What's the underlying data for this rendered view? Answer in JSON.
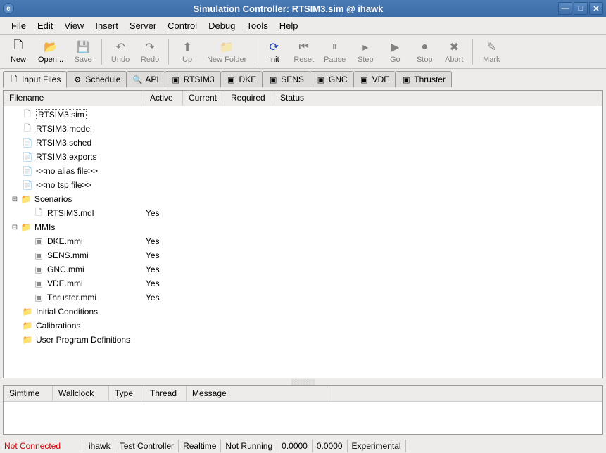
{
  "title": "Simulation Controller: RTSIM3.sim @ ihawk",
  "menu": [
    "File",
    "Edit",
    "View",
    "Insert",
    "Server",
    "Control",
    "Debug",
    "Tools",
    "Help"
  ],
  "toolbar": [
    {
      "label": "New",
      "icon": "🗋",
      "enabled": true
    },
    {
      "label": "Open...",
      "icon": "📂",
      "enabled": true
    },
    {
      "label": "Save",
      "icon": "💾",
      "enabled": false
    },
    {
      "sep": true
    },
    {
      "label": "Undo",
      "icon": "↶",
      "enabled": false
    },
    {
      "label": "Redo",
      "icon": "↷",
      "enabled": false
    },
    {
      "sep": true
    },
    {
      "label": "Up",
      "icon": "⬆",
      "enabled": false
    },
    {
      "label": "New Folder",
      "icon": "📁",
      "enabled": false
    },
    {
      "sep": true
    },
    {
      "label": "Init",
      "icon": "⟳",
      "enabled": true,
      "blue": true
    },
    {
      "label": "Reset",
      "icon": "⏮",
      "enabled": false
    },
    {
      "label": "Pause",
      "icon": "⏸",
      "enabled": false
    },
    {
      "label": "Step",
      "icon": "▸",
      "enabled": false
    },
    {
      "label": "Go",
      "icon": "▶",
      "enabled": false
    },
    {
      "label": "Stop",
      "icon": "●",
      "enabled": false
    },
    {
      "label": "Abort",
      "icon": "✖",
      "enabled": false
    },
    {
      "sep": true
    },
    {
      "label": "Mark",
      "icon": "✎",
      "enabled": false
    }
  ],
  "tabs": [
    {
      "label": "Input Files",
      "icon": "🗋",
      "active": true
    },
    {
      "label": "Schedule",
      "icon": "⚙",
      "active": false
    },
    {
      "label": "API",
      "icon": "🔍",
      "active": false
    },
    {
      "label": "RTSIM3",
      "icon": "▣",
      "active": false
    },
    {
      "label": "DKE",
      "icon": "▣",
      "active": false
    },
    {
      "label": "SENS",
      "icon": "▣",
      "active": false
    },
    {
      "label": "GNC",
      "icon": "▣",
      "active": false
    },
    {
      "label": "VDE",
      "icon": "▣",
      "active": false
    },
    {
      "label": "Thruster",
      "icon": "▣",
      "active": false
    }
  ],
  "treeHeaders": [
    "Filename",
    "Active",
    "Current",
    "Required",
    "Status"
  ],
  "tree": [
    {
      "indent": 1,
      "icon": "🗋",
      "label": "RTSIM3.sim",
      "selected": true
    },
    {
      "indent": 1,
      "icon": "🗋",
      "label": "RTSIM3.model"
    },
    {
      "indent": 1,
      "icon": "📄",
      "label": "RTSIM3.sched",
      "yellow": true
    },
    {
      "indent": 1,
      "icon": "📄",
      "label": "RTSIM3.exports",
      "yellow": true
    },
    {
      "indent": 1,
      "icon": "📄",
      "label": "<<no alias file>>",
      "yellow": true
    },
    {
      "indent": 1,
      "icon": "📄",
      "label": "<<no tsp file>>"
    },
    {
      "indent": 0,
      "expander": "−",
      "icon": "📁",
      "label": "Scenarios",
      "folder": true
    },
    {
      "indent": 2,
      "icon": "🗋",
      "label": "RTSIM3.mdl",
      "active": "Yes"
    },
    {
      "indent": 0,
      "expander": "−",
      "icon": "📁",
      "label": "MMIs",
      "folder": true
    },
    {
      "indent": 2,
      "icon": "▣",
      "label": "DKE.mmi",
      "active": "Yes"
    },
    {
      "indent": 2,
      "icon": "▣",
      "label": "SENS.mmi",
      "active": "Yes"
    },
    {
      "indent": 2,
      "icon": "▣",
      "label": "GNC.mmi",
      "active": "Yes"
    },
    {
      "indent": 2,
      "icon": "▣",
      "label": "VDE.mmi",
      "active": "Yes"
    },
    {
      "indent": 2,
      "icon": "▣",
      "label": "Thruster.mmi",
      "active": "Yes"
    },
    {
      "indent": 1,
      "icon": "📁",
      "label": "Initial Conditions",
      "folder": true
    },
    {
      "indent": 1,
      "icon": "📁",
      "label": "Calibrations",
      "folder": true
    },
    {
      "indent": 1,
      "icon": "📁",
      "label": "User Program Definitions",
      "folder": true
    }
  ],
  "logHeaders": [
    "Simtime",
    "Wallclock",
    "Type",
    "Thread",
    "Message"
  ],
  "status": {
    "connection": "Not Connected",
    "host": "ihawk",
    "controller": "Test Controller",
    "mode": "Realtime",
    "running": "Not Running",
    "t1": "0.0000",
    "t2": "0.0000",
    "build": "Experimental"
  }
}
